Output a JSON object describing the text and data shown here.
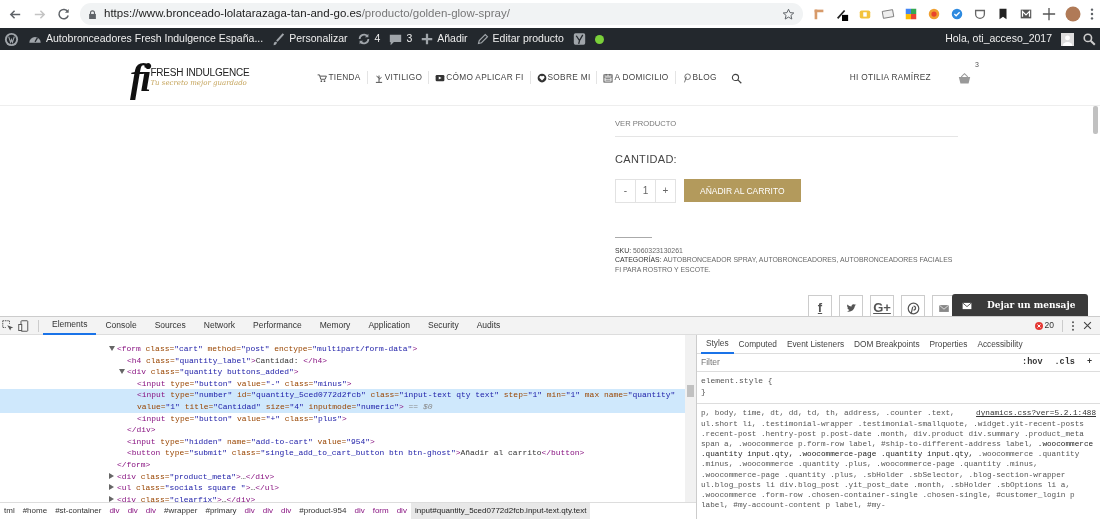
{
  "browser": {
    "nav_buttons": [
      {
        "kind": "back",
        "disabled": false
      },
      {
        "kind": "forward",
        "disabled": true
      },
      {
        "kind": "reload",
        "disabled": false
      }
    ],
    "url": {
      "host": "https://www.bronceado-lolatarazaga-tan-and-go.es",
      "path": "/producto/golden-glow-spray/"
    }
  },
  "admin_bar": {
    "items": [
      {
        "kind": "wordpress"
      },
      {
        "kind": "site",
        "label": "Autobronceadores Fresh Indulgence España..."
      },
      {
        "kind": "customize",
        "label": "Personalizar"
      },
      {
        "kind": "updates",
        "label": "4"
      },
      {
        "kind": "comments",
        "label": "3"
      },
      {
        "kind": "add",
        "label": "Añadir"
      },
      {
        "kind": "edit",
        "label": "Editar producto"
      },
      {
        "kind": "seo"
      },
      {
        "kind": "status",
        "color": "#7ad03a"
      }
    ],
    "greeting": "Hola, oti_acceso_2017"
  },
  "site": {
    "logo": {
      "mark": "fi",
      "name": "FRESH INDULGENCE",
      "tagline": "Tu secreto mejor guardado"
    },
    "nav": [
      {
        "kind": "shop",
        "label": "TIENDA"
      },
      {
        "kind": "plant",
        "label": "VITILIGO"
      },
      {
        "kind": "video",
        "label": "CÓMO APLICAR FI"
      },
      {
        "kind": "heart",
        "label": "SOBRE MI"
      },
      {
        "kind": "calendar",
        "label": "A DOMICILIO"
      },
      {
        "kind": "pin",
        "label": "BLOG"
      },
      {
        "kind": "search"
      }
    ],
    "user": "HI OTILIA RAMÍREZ",
    "cart_count": "3"
  },
  "product": {
    "view_link": "VER PRODUCTO",
    "quantity_label": "CANTIDAD:",
    "quantity": {
      "minus": "-",
      "value": "1",
      "plus": "+"
    },
    "add_button": "AÑADIR AL CARRITO",
    "sku_label": "SKU:",
    "sku": "5060323130261",
    "categories_label": "CATEGORÍAS:",
    "categories": "AUTOBRONCEADOR SPRAY, AUTOBRONCEADORES, AUTOBRONCEADORES FACIALES FI PARA ROSTRO Y ESCOTE.",
    "social": [
      {
        "kind": "facebook",
        "label": "f"
      },
      {
        "kind": "twitter"
      },
      {
        "kind": "googleplus",
        "label": "G+"
      },
      {
        "kind": "pinterest"
      },
      {
        "kind": "email"
      }
    ],
    "chat": "Dejar un mensaje"
  },
  "devtools": {
    "tabs": [
      {
        "label": "Elements",
        "selected": true
      },
      {
        "label": "Console",
        "selected": false
      },
      {
        "label": "Sources",
        "selected": false
      },
      {
        "label": "Network",
        "selected": false
      },
      {
        "label": "Performance",
        "selected": false
      },
      {
        "label": "Memory",
        "selected": false
      },
      {
        "label": "Application",
        "selected": false
      },
      {
        "label": "Security",
        "selected": false
      },
      {
        "label": "Audits",
        "selected": false
      }
    ],
    "error_count": "20",
    "dom": [
      {
        "text": "<form class=\"cart\" method=\"post\" enctype=\"multipart/form-data\">",
        "expanded": true,
        "selected": false,
        "closing": "</form>",
        "children": [
          {
            "text": "<h4 class=\"quantity_label\">Cantidad: </h4>",
            "selected": false
          },
          {
            "text": "<div class=\"quantity buttons_added\">",
            "expanded": true,
            "selected": false,
            "closing": "</div>",
            "children": [
              {
                "text": "<input type=\"button\" value=\"-\" class=\"minus\">",
                "selected": false
              },
              {
                "text": "<input type=\"number\" id=\"quantity_5ced0772d2fcb\" class=\"input-text qty text\" step=\"1\" min=\"1\" max name=\"quantity\" value=\"1\" title=\"Cantidad\" size=\"4\" inputmode=\"numeric\">",
                "note": "== $0",
                "selected": true
              },
              {
                "text": "<input type=\"button\" value=\"+\" class=\"plus\">",
                "selected": false
              }
            ]
          },
          {
            "text": "<input type=\"hidden\" name=\"add-to-cart\" value=\"954\">",
            "selected": false
          },
          {
            "text": "<button type=\"submit\" class=\"single_add_to_cart_button btn btn-ghost\">Añadir al carrito</button>",
            "selected": false
          }
        ]
      },
      {
        "text": "<div class=\"product_meta\">…</div>",
        "expanded": false,
        "selected": false
      },
      {
        "text": "<ul class=\"socials square \">…</ul>",
        "expanded": false,
        "selected": false
      },
      {
        "text": "<div class=\"clearfix\">…</div>",
        "expanded": false,
        "selected": false
      }
    ],
    "breadcrumb": [
      {
        "label": "tml",
        "selected": false
      },
      {
        "label": "#home",
        "selected": false
      },
      {
        "label": "#st-container",
        "selected": false
      },
      {
        "label": "div",
        "selected": false
      },
      {
        "label": "div",
        "selected": false
      },
      {
        "label": "div",
        "selected": false
      },
      {
        "label": "#wrapper",
        "selected": false
      },
      {
        "label": "#primary",
        "selected": false
      },
      {
        "label": "div",
        "selected": false
      },
      {
        "label": "div",
        "selected": false
      },
      {
        "label": "div",
        "selected": false
      },
      {
        "label": "#product-954",
        "selected": false
      },
      {
        "label": "div",
        "selected": false
      },
      {
        "label": "form",
        "selected": false
      },
      {
        "label": "div",
        "selected": false
      },
      {
        "label": "input#quantity_5ced0772d2fcb.input-text.qty.text",
        "selected": true
      }
    ],
    "side_tabs": [
      {
        "label": "Styles",
        "selected": true
      },
      {
        "label": "Computed",
        "selected": false
      },
      {
        "label": "Event Listeners",
        "selected": false
      },
      {
        "label": "DOM Breakpoints",
        "selected": false
      },
      {
        "label": "Properties",
        "selected": false
      },
      {
        "label": "Accessibility",
        "selected": false
      }
    ],
    "filter": {
      "placeholder": "Filter"
    },
    "filter_buttons": [
      ":hov",
      ".cls",
      "+"
    ],
    "element_style": {
      "open": "element.style {",
      "close": "}"
    },
    "rule": {
      "source": "dynamics.css?ver=5.2.1:488",
      "selector_lines": [
        "p, body, time, dt, dd, td, th, address, .counter .text,",
        "ul.short li, .testimonial-wrapper .testimonial-smallquote, .widget.yit-recent-posts .recent-post .hentry-post p.post-date .month, div.product div.summary .product_meta span a, .woocommerce p.form-row label, #ship-to-different-address label, **.woocommerce .quantity input.qty, .woocommerce-page .quantity input.qty,** .woocommerce .quantity .minus, .woocommerce .quantity .plus, .woocommerce-page .quantity .minus, .woocommerce-page .quantity .plus, .sbHolder .sbSelector, .blog-section-wrapper ul.blog_posts li div.blog_post .yit_post_date .month, .sbHolder .sbOptions li a, .woocommerce .form-row .chosen-container-single .chosen-single, #customer_login p label, #my-account-content p label, #my-"
      ]
    }
  }
}
